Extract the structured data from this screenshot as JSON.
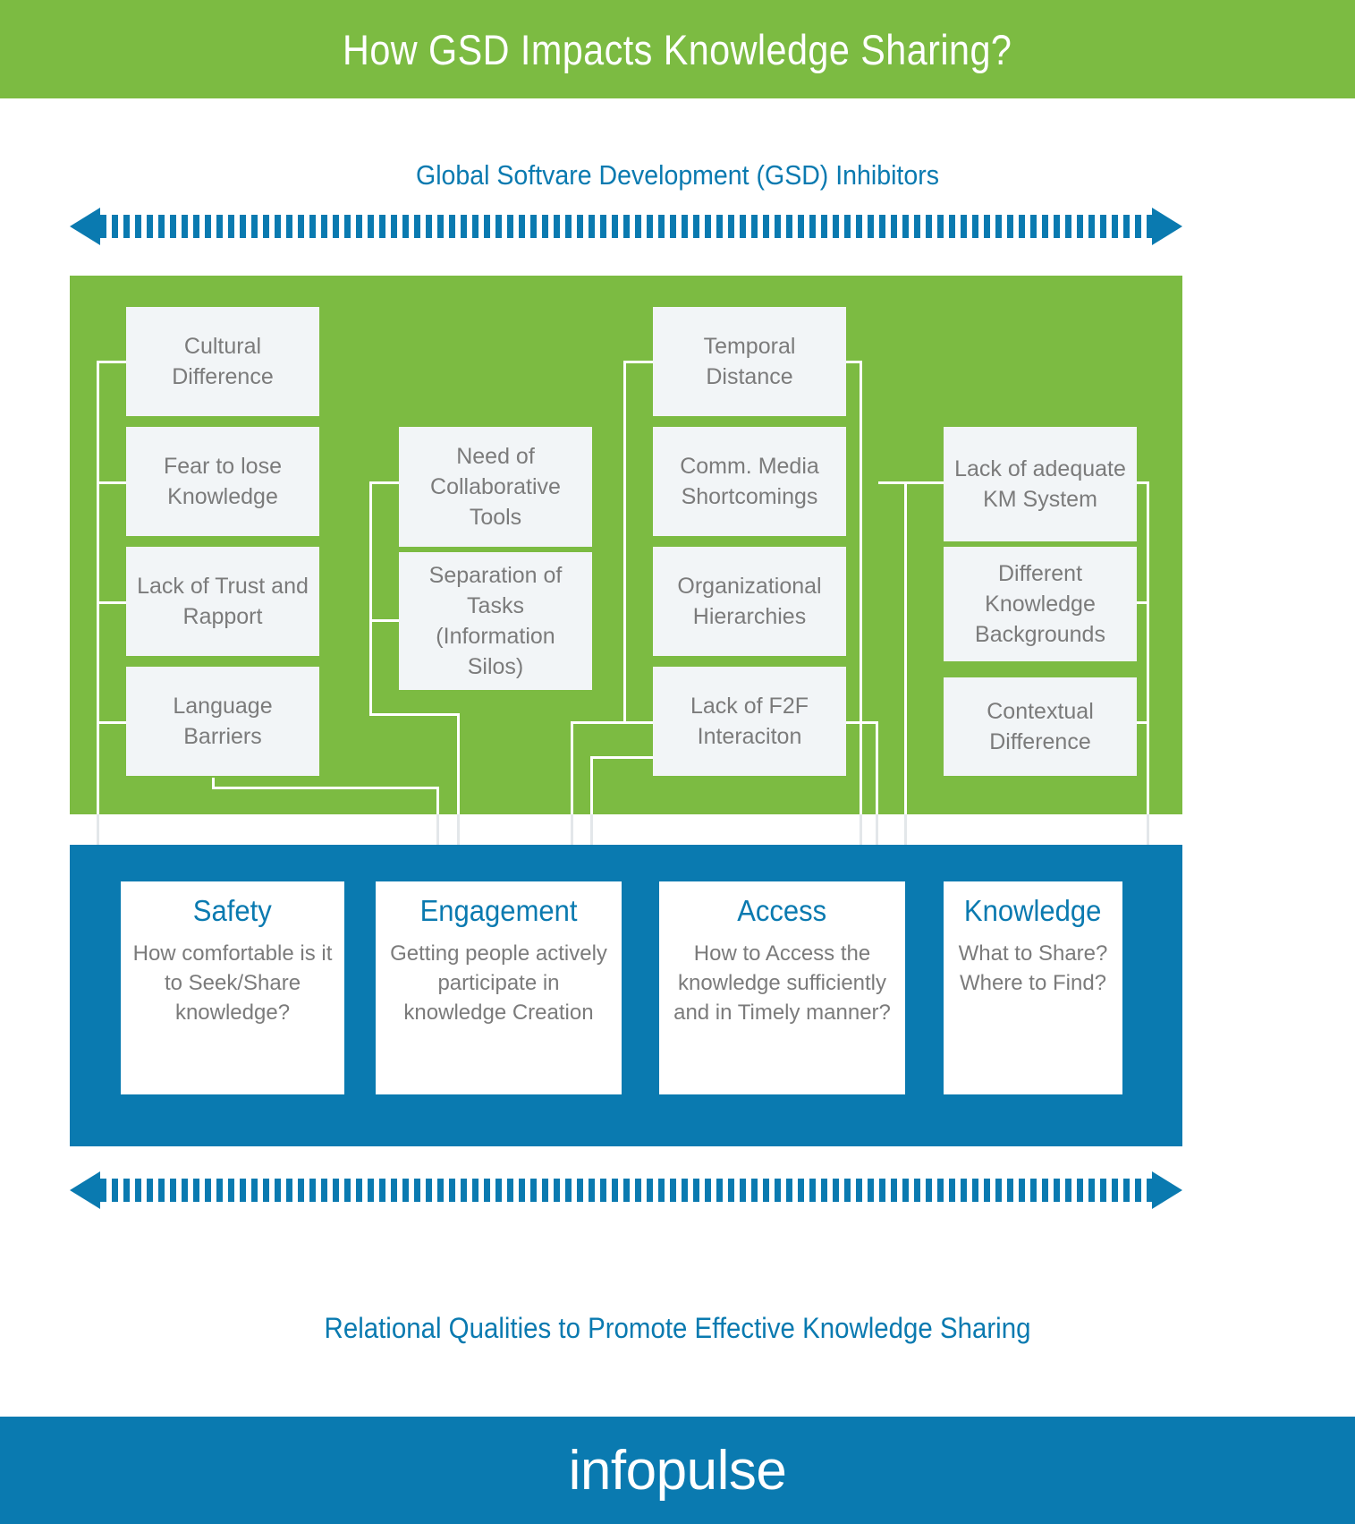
{
  "header": {
    "title": "How GSD Impacts Knowledge Sharing?"
  },
  "top_caption": "Global Softvare Development (GSD) Inhibitors",
  "bottom_caption": "Relational Qualities to Promote Effective Knowledge Sharing",
  "footer": {
    "logo": "infopulse"
  },
  "colors": {
    "green": "#7cbb42",
    "blue": "#0a7ab0",
    "box_fill": "#f2f5f7",
    "text_gray": "#7b7b7b",
    "white": "#ffffff"
  },
  "arrows": {
    "top_name": "double-headed-dashed-arrow-top",
    "bottom_name": "double-headed-dashed-arrow-bottom"
  },
  "inhibitors": {
    "columns": [
      {
        "name": "column-1",
        "items": [
          {
            "label": "Cultural Difference"
          },
          {
            "label": "Fear to lose Knowledge"
          },
          {
            "label": "Lack of Trust and Rapport"
          },
          {
            "label": "Language Barriers"
          }
        ]
      },
      {
        "name": "column-2",
        "items": [
          {
            "label": "Need of Collaborative Tools"
          },
          {
            "label": "Separation of Tasks (Information Silos)"
          }
        ]
      },
      {
        "name": "column-3",
        "items": [
          {
            "label": "Temporal Distance"
          },
          {
            "label": "Comm. Media Shortcomings"
          },
          {
            "label": "Organizational Hierarchies"
          },
          {
            "label": "Lack of F2F Interaciton"
          }
        ]
      },
      {
        "name": "column-4",
        "items": [
          {
            "label": "Lack of adequate KM System"
          },
          {
            "label": "Different Knowledge Backgrounds"
          },
          {
            "label": "Contextual Difference"
          }
        ]
      }
    ]
  },
  "outcomes": [
    {
      "title": "Safety",
      "description": "How comfortable is it to Seek/Share knowledge?"
    },
    {
      "title": "Engagement",
      "description": "Getting people actively participate in knowledge Creation"
    },
    {
      "title": "Access",
      "description": "How to Access the knowledge sufficiently and in Timely manner?"
    },
    {
      "title": "Knowledge",
      "description": "What to Share? Where to Find?"
    }
  ]
}
